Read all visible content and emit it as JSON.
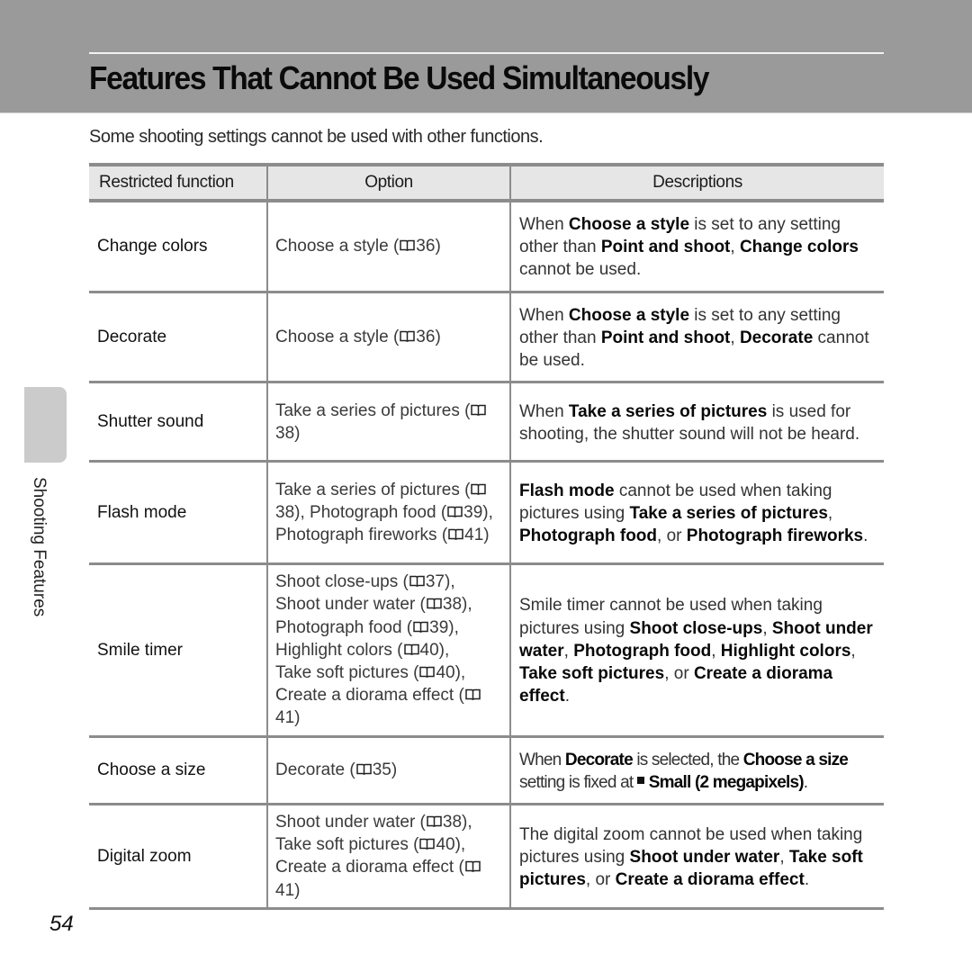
{
  "header": {
    "title": "Features That Cannot Be Used Simultaneously",
    "intro": "Some shooting settings cannot be used with other functions."
  },
  "side_tab": {
    "label": "Shooting Features"
  },
  "page_number": "54",
  "table": {
    "headers": [
      "Restricted function",
      "Option",
      "Descriptions"
    ],
    "rows": [
      {
        "function": "Change colors",
        "options": [
          {
            "text": "Choose a style (",
            "icon": "book-icon",
            "page": "36",
            "suffix": ")"
          }
        ],
        "description": [
          {
            "t": "When "
          },
          {
            "b": "Choose a style"
          },
          {
            "t": " is set to any setting other than "
          },
          {
            "b": "Point and shoot"
          },
          {
            "t": ", "
          },
          {
            "b": "Change colors"
          },
          {
            "t": " cannot be used."
          }
        ]
      },
      {
        "function": "Decorate",
        "options": [
          {
            "text": "Choose a style (",
            "icon": "book-icon",
            "page": "36",
            "suffix": ")"
          }
        ],
        "description": [
          {
            "t": "When "
          },
          {
            "b": "Choose a style"
          },
          {
            "t": " is set to any setting other than "
          },
          {
            "b": "Point and shoot"
          },
          {
            "t": ", "
          },
          {
            "b": "Decorate"
          },
          {
            "t": " cannot be used."
          }
        ]
      },
      {
        "function": "Shutter sound",
        "options": [
          {
            "text": "Take a series of pictures (",
            "icon": "book-icon",
            "page": "38",
            "suffix": ")"
          }
        ],
        "description": [
          {
            "t": "When "
          },
          {
            "b": "Take a series of pictures"
          },
          {
            "t": " is used for shooting, the shutter sound will not be heard."
          }
        ]
      },
      {
        "function": "Flash mode",
        "options": [
          {
            "text": "Take a series of pictures (",
            "icon": "book-icon",
            "page": "38",
            "suffix": "), "
          },
          {
            "text": "Photograph food (",
            "icon": "book-icon",
            "page": "39",
            "suffix": "), "
          },
          {
            "text": "Photograph fireworks (",
            "icon": "book-icon",
            "page": "41",
            "suffix": ")"
          }
        ],
        "description": [
          {
            "b": "Flash mode"
          },
          {
            "t": " cannot be used when taking pictures using "
          },
          {
            "b": "Take a series of pictures"
          },
          {
            "t": ", "
          },
          {
            "b": "Photograph food"
          },
          {
            "t": ", or "
          },
          {
            "b": "Photograph fireworks"
          },
          {
            "t": "."
          }
        ]
      },
      {
        "function": "Smile timer",
        "options": [
          {
            "text": "Shoot close-ups (",
            "icon": "book-icon",
            "page": "37",
            "suffix": "), ",
            "br": true
          },
          {
            "text": "Shoot under water (",
            "icon": "book-icon",
            "page": "38",
            "suffix": "), ",
            "br": true
          },
          {
            "text": "Photograph food (",
            "icon": "book-icon",
            "page": "39",
            "suffix": "), ",
            "br": true
          },
          {
            "text": "Highlight colors (",
            "icon": "book-icon",
            "page": "40",
            "suffix": "), ",
            "br": true
          },
          {
            "text": "Take soft pictures (",
            "icon": "book-icon",
            "page": "40",
            "suffix": "), ",
            "br": true
          },
          {
            "text": "Create a diorama effect (",
            "icon": "book-icon",
            "page": "41",
            "suffix": ")"
          }
        ],
        "description": [
          {
            "t": "Smile timer cannot be used when taking pictures using "
          },
          {
            "b": "Shoot close-ups"
          },
          {
            "t": ", "
          },
          {
            "b": "Shoot under water"
          },
          {
            "t": ", "
          },
          {
            "b": "Photograph food"
          },
          {
            "t": ", "
          },
          {
            "b": "Highlight colors"
          },
          {
            "t": ", "
          },
          {
            "b": "Take soft pictures"
          },
          {
            "t": ", or "
          },
          {
            "b": "Create a diorama effect"
          },
          {
            "t": "."
          }
        ]
      },
      {
        "function": "Choose a size",
        "options": [
          {
            "text": "Decorate (",
            "icon": "book-icon",
            "page": "35",
            "suffix": ")"
          }
        ],
        "condensed": true,
        "description": [
          {
            "t": "When "
          },
          {
            "b": "Decorate"
          },
          {
            "t": " is selected, the "
          },
          {
            "b": "Choose a size"
          },
          {
            "t": " setting is fixed at "
          },
          {
            "icon": "small-size-icon"
          },
          {
            "b": "Small (2 megapixels)"
          },
          {
            "t": "."
          }
        ]
      },
      {
        "function": "Digital zoom",
        "options": [
          {
            "text": "Shoot under water (",
            "icon": "book-icon",
            "page": "38",
            "suffix": "), ",
            "br": true
          },
          {
            "text": "Take soft pictures (",
            "icon": "book-icon",
            "page": "40",
            "suffix": "), ",
            "br": true
          },
          {
            "text": "Create a diorama effect (",
            "icon": "book-icon",
            "page": "41",
            "suffix": ")"
          }
        ],
        "description": [
          {
            "t": "The digital zoom cannot be used when taking pictures using "
          },
          {
            "b": "Shoot under water"
          },
          {
            "t": ", "
          },
          {
            "b": "Take soft pictures"
          },
          {
            "t": ", or "
          },
          {
            "b": "Create a diorama effect"
          },
          {
            "t": "."
          }
        ]
      }
    ]
  }
}
